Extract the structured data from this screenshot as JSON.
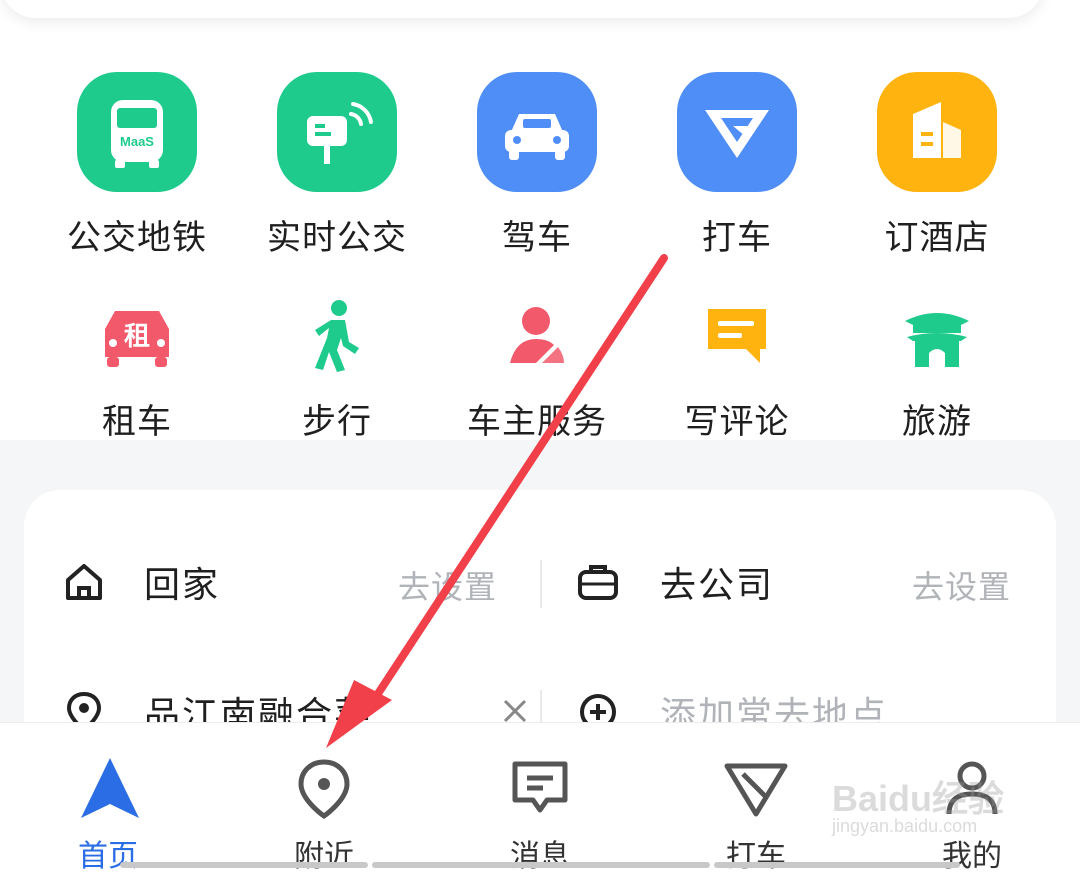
{
  "services_row1": [
    {
      "label": "公交地铁",
      "icon": "bus-maas-icon",
      "color": "#1ecb8c",
      "badge": "MaaS"
    },
    {
      "label": "实时公交",
      "icon": "bus-stop-signal-icon",
      "color": "#1ecb8c"
    },
    {
      "label": "驾车",
      "icon": "car-icon",
      "color": "#4f8ef7"
    },
    {
      "label": "打车",
      "icon": "taxi-v-icon",
      "color": "#4f8ef7"
    },
    {
      "label": "订酒店",
      "icon": "hotel-building-icon",
      "color": "#ffb30f"
    }
  ],
  "services_row2": [
    {
      "label": "租车",
      "icon": "rental-car-icon",
      "color": "#f25a6c",
      "glyph": "租"
    },
    {
      "label": "步行",
      "icon": "walking-person-icon",
      "color": "#1ecb8c"
    },
    {
      "label": "车主服务",
      "icon": "car-owner-icon",
      "color": "#f25a6c"
    },
    {
      "label": "写评论",
      "icon": "comment-icon",
      "color": "#ffb30f"
    },
    {
      "label": "旅游",
      "icon": "travel-gate-icon",
      "color": "#1ecb8c"
    }
  ],
  "favorites": {
    "home": {
      "label": "回家",
      "action": "去设置",
      "icon": "home-icon"
    },
    "company": {
      "label": "去公司",
      "action": "去设置",
      "icon": "briefcase-icon"
    },
    "recent": {
      "label": "品江南融合菜…",
      "icon": "location-pin-icon"
    },
    "add_place": {
      "label": "添加常去地点",
      "icon": "add-circle-icon"
    }
  },
  "tabs": [
    {
      "label": "首页",
      "icon": "navigation-arrow-icon",
      "active": true
    },
    {
      "label": "附近",
      "icon": "location-pin-icon",
      "active": false
    },
    {
      "label": "消息",
      "icon": "message-icon",
      "active": false
    },
    {
      "label": "打车",
      "icon": "taxi-v-icon",
      "active": false
    },
    {
      "label": "我的",
      "icon": "user-icon",
      "active": false
    }
  ],
  "watermark": {
    "main": "Baidu经验",
    "sub": "jingyan.baidu.com"
  },
  "colors": {
    "accent": "#2a6de5",
    "annotation_arrow": "#f2404a"
  }
}
